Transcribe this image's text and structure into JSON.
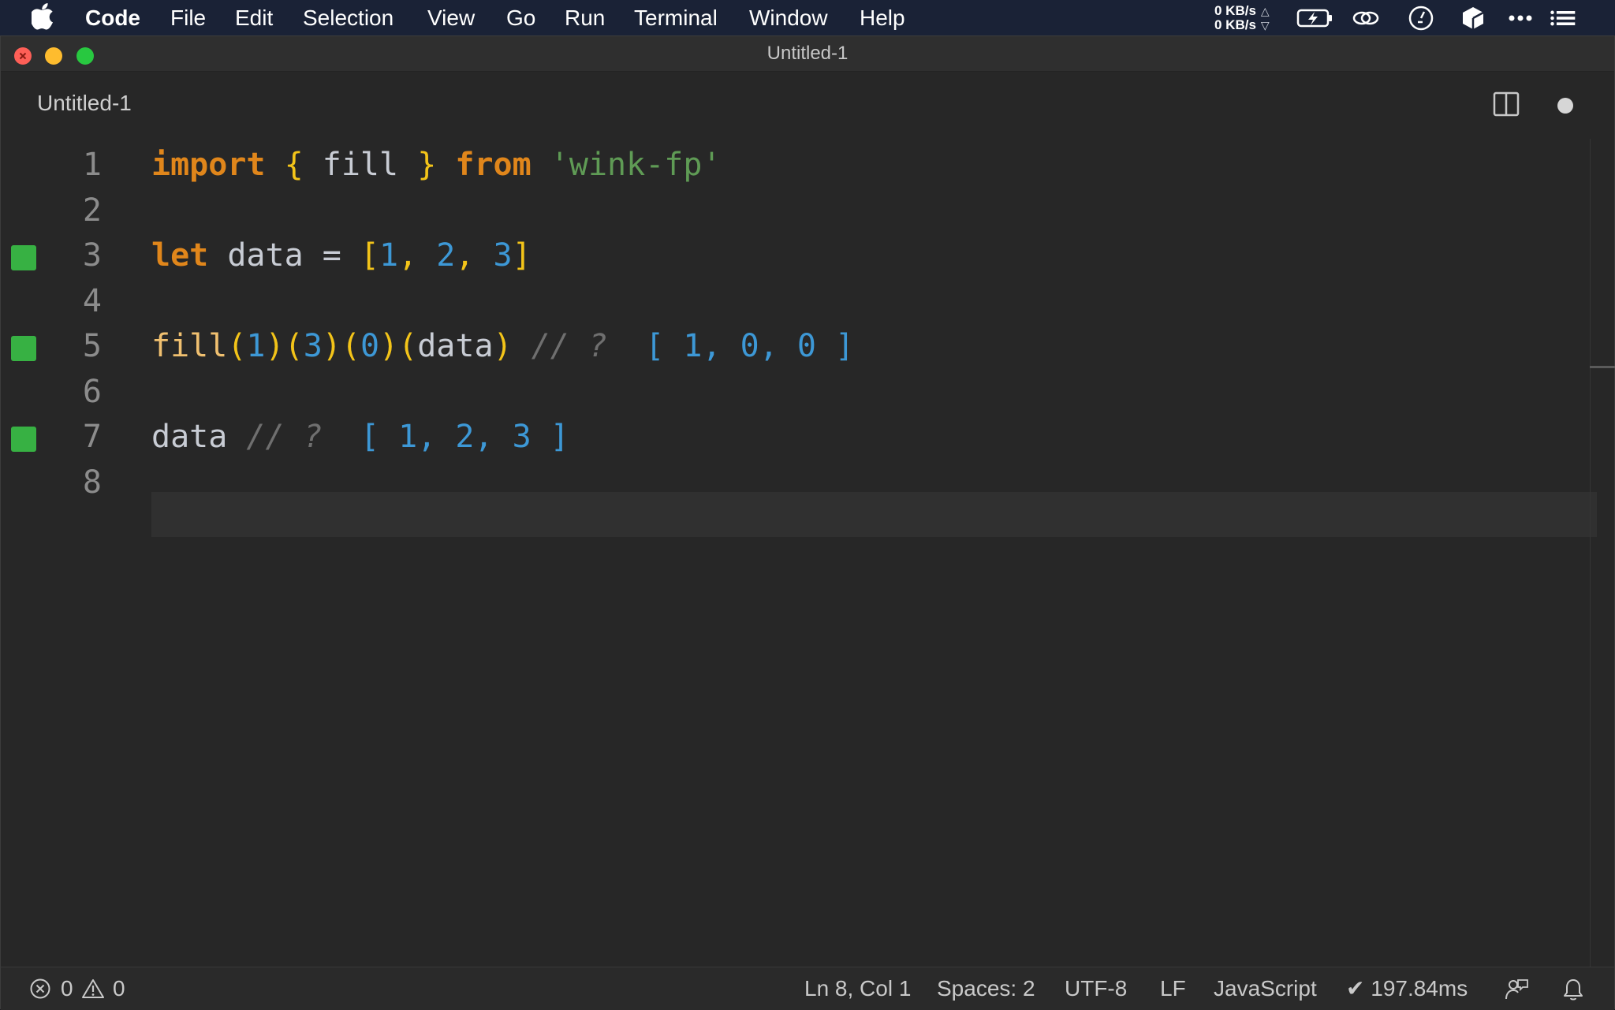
{
  "menubar": {
    "app_name": "Code",
    "items": [
      "File",
      "Edit",
      "Selection",
      "View",
      "Go",
      "Run",
      "Terminal",
      "Window",
      "Help"
    ],
    "net_up": "0 KB/s",
    "net_down": "0 KB/s"
  },
  "window": {
    "title": "Untitled-1",
    "tab_label": "Untitled-1"
  },
  "editor": {
    "language": "JavaScript",
    "cursor_line": 8,
    "lines": [
      {
        "number": "1",
        "marker": false,
        "tokens": [
          {
            "t": "import",
            "c": "kw"
          },
          {
            "t": " ",
            "c": "id"
          },
          {
            "t": "{",
            "c": "br"
          },
          {
            "t": " fill ",
            "c": "id"
          },
          {
            "t": "}",
            "c": "br"
          },
          {
            "t": " ",
            "c": "id"
          },
          {
            "t": "from",
            "c": "kw"
          },
          {
            "t": " ",
            "c": "id"
          },
          {
            "t": "'wink-fp'",
            "c": "str"
          }
        ]
      },
      {
        "number": "2",
        "marker": false,
        "tokens": []
      },
      {
        "number": "3",
        "marker": true,
        "tokens": [
          {
            "t": "let",
            "c": "kw"
          },
          {
            "t": " data = ",
            "c": "id"
          },
          {
            "t": "[",
            "c": "br"
          },
          {
            "t": "1",
            "c": "num"
          },
          {
            "t": ", ",
            "c": "br"
          },
          {
            "t": "2",
            "c": "num"
          },
          {
            "t": ", ",
            "c": "br"
          },
          {
            "t": "3",
            "c": "num"
          },
          {
            "t": "]",
            "c": "br"
          }
        ]
      },
      {
        "number": "4",
        "marker": false,
        "tokens": []
      },
      {
        "number": "5",
        "marker": true,
        "tokens": [
          {
            "t": "fill",
            "c": "fn"
          },
          {
            "t": "(",
            "c": "br"
          },
          {
            "t": "1",
            "c": "num"
          },
          {
            "t": ")(",
            "c": "br"
          },
          {
            "t": "3",
            "c": "num"
          },
          {
            "t": ")(",
            "c": "br"
          },
          {
            "t": "0",
            "c": "num"
          },
          {
            "t": ")(",
            "c": "br"
          },
          {
            "t": "data",
            "c": "id"
          },
          {
            "t": ")",
            "c": "br"
          },
          {
            "t": " // ? ",
            "c": "cmt"
          },
          {
            "t": " [ 1, 0, 0 ]",
            "c": "res"
          }
        ]
      },
      {
        "number": "6",
        "marker": false,
        "tokens": []
      },
      {
        "number": "7",
        "marker": true,
        "tokens": [
          {
            "t": "data",
            "c": "id"
          },
          {
            "t": " // ? ",
            "c": "cmt"
          },
          {
            "t": " [ 1, 2, 3 ]",
            "c": "res"
          }
        ]
      },
      {
        "number": "8",
        "marker": false,
        "tokens": []
      }
    ]
  },
  "statusbar": {
    "errors": "0",
    "warnings": "0",
    "position": "Ln 8, Col 1",
    "spaces": "Spaces: 2",
    "encoding": "UTF-8",
    "eol": "LF",
    "language": "JavaScript",
    "timing": "✔ 197.84ms"
  },
  "colors": {
    "keyword": "#e0861b",
    "bracket": "#f3c419",
    "string": "#5f9b55",
    "number": "#3d98d6",
    "marker": "#37b143"
  }
}
